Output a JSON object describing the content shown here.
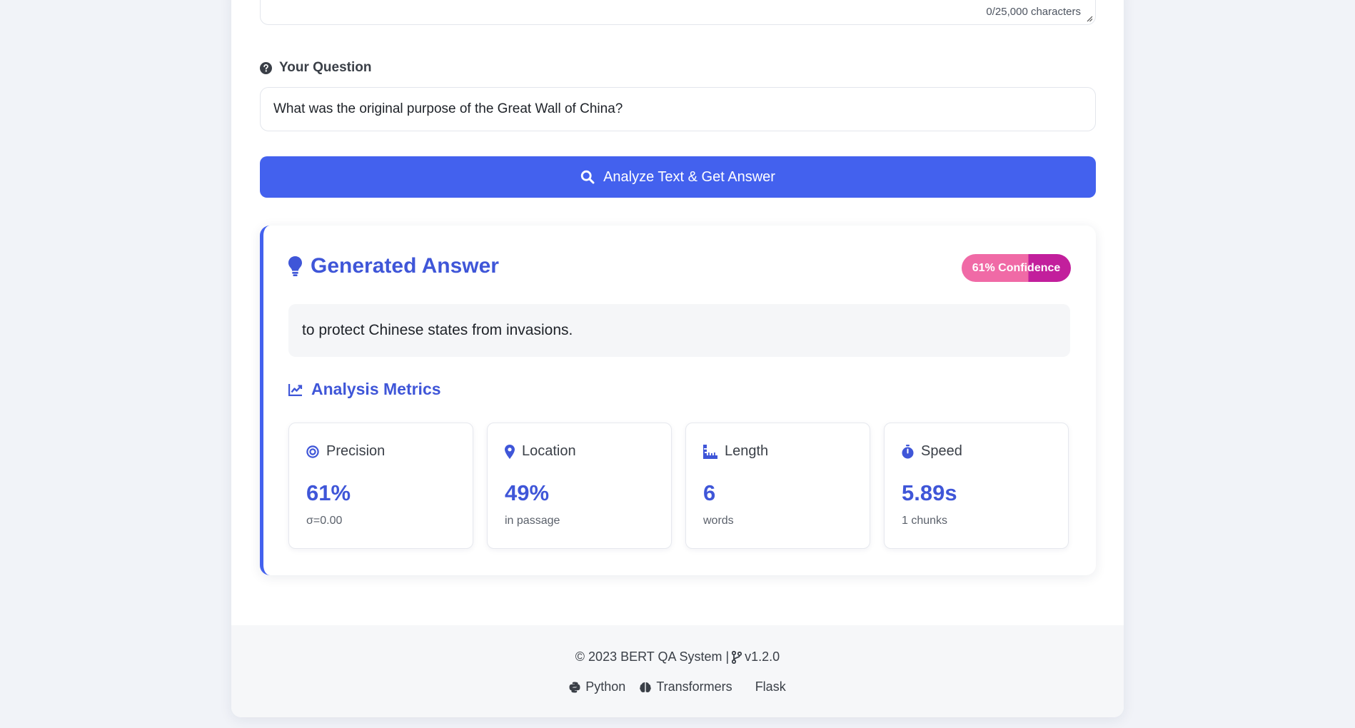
{
  "passage": {
    "char_count": "0/25,000 characters"
  },
  "question": {
    "label": "Your Question",
    "value": "What was the original purpose of the Great Wall of China?",
    "icon": "question-circle-icon"
  },
  "analyze_button": {
    "label": "Analyze Text & Get Answer",
    "icon": "search-icon",
    "color": "#4361ee"
  },
  "answer": {
    "title": "Generated Answer",
    "icon": "lightbulb-icon",
    "confidence_label": "61% Confidence",
    "confidence_value": 0.61,
    "text": "to protect Chinese states from invasions."
  },
  "metrics": {
    "title": "Analysis Metrics",
    "icon": "chart-line-icon",
    "items": [
      {
        "label": "Precision",
        "value": "61%",
        "sub": "σ=0.00",
        "icon": "target-icon"
      },
      {
        "label": "Location",
        "value": "49%",
        "sub": "in passage",
        "icon": "map-pin-icon"
      },
      {
        "label": "Length",
        "value": "6",
        "sub": "words",
        "icon": "ruler-icon"
      },
      {
        "label": "Speed",
        "value": "5.89s",
        "sub": "1 chunks",
        "icon": "stopwatch-icon"
      }
    ]
  },
  "footer": {
    "copyright": "© 2023 BERT QA System |",
    "version": "v1.2.0",
    "tech": [
      "Python",
      "Transformers",
      "Flask"
    ]
  },
  "colors": {
    "accent": "#4361ee",
    "confidence_light": "#f06aa6",
    "confidence_dark": "#c21f9c"
  }
}
